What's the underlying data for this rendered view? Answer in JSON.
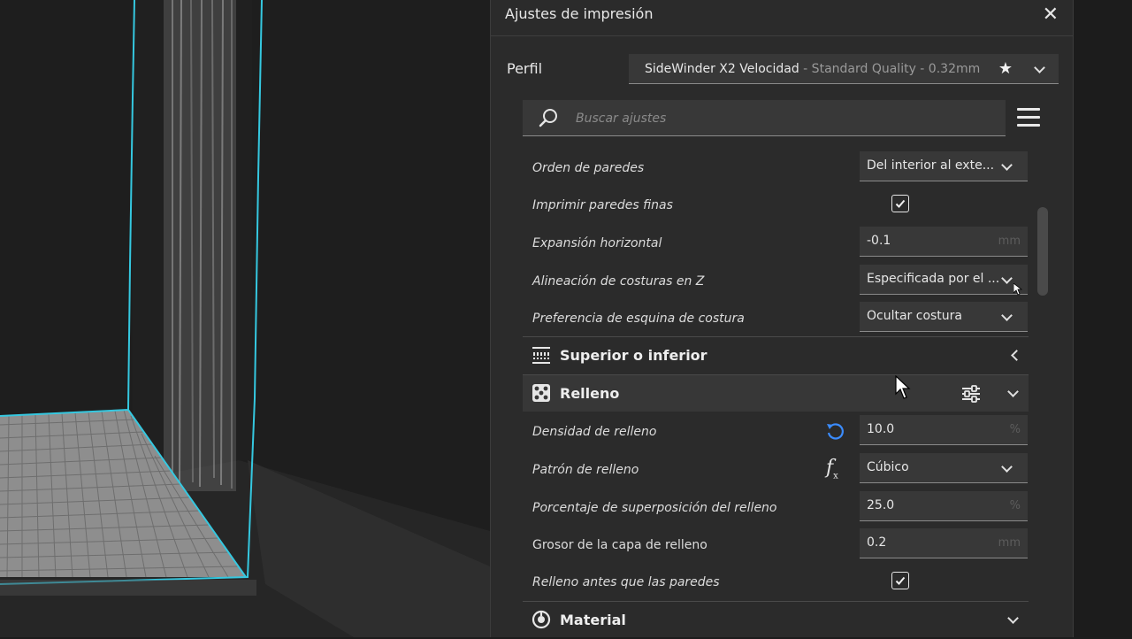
{
  "panel": {
    "title": "Ajustes de impresión",
    "close_glyph": "✕"
  },
  "profile": {
    "label": "Perfil",
    "printer": "SideWinder X2 Velocidad",
    "quality": " - Standard Quality - 0.32mm",
    "favorite_icon": "star-icon"
  },
  "search": {
    "placeholder": "Buscar ajustes",
    "value": ""
  },
  "settings": {
    "wall_order": {
      "label": "Orden de paredes",
      "value": "Del interior al exte..."
    },
    "print_thin_walls": {
      "label": "Imprimir paredes finas",
      "checked": true
    },
    "horizontal_expansion": {
      "label": "Expansión horizontal",
      "value": "-0.1",
      "unit": "mm"
    },
    "z_seam_alignment": {
      "label": "Alineación de costuras en Z",
      "value": "Especificada por el ..."
    },
    "seam_corner_pref": {
      "label": "Preferencia de esquina de costura",
      "value": "Ocultar costura"
    }
  },
  "categories": {
    "top_bottom": {
      "label": "Superior o inferior",
      "expanded": false
    },
    "infill": {
      "label": "Relleno",
      "expanded": true
    },
    "material": {
      "label": "Material",
      "expanded": false
    }
  },
  "infill": {
    "density": {
      "label": "Densidad de relleno",
      "value": "10.0",
      "unit": "%"
    },
    "pattern": {
      "label": "Patrón de relleno",
      "value": "Cúbico"
    },
    "overlap": {
      "label": "Porcentaje de superposición del relleno",
      "value": "25.0",
      "unit": "%"
    },
    "layer_thickness": {
      "label": "Grosor de la capa de relleno",
      "value": "0.2",
      "unit": "mm"
    },
    "before_walls": {
      "label": "Relleno antes que las paredes",
      "checked": true
    }
  },
  "colors": {
    "panel_bg": "#2b2b2b",
    "accent_blue": "#3b8cff",
    "model_outline": "#35c8e0"
  }
}
